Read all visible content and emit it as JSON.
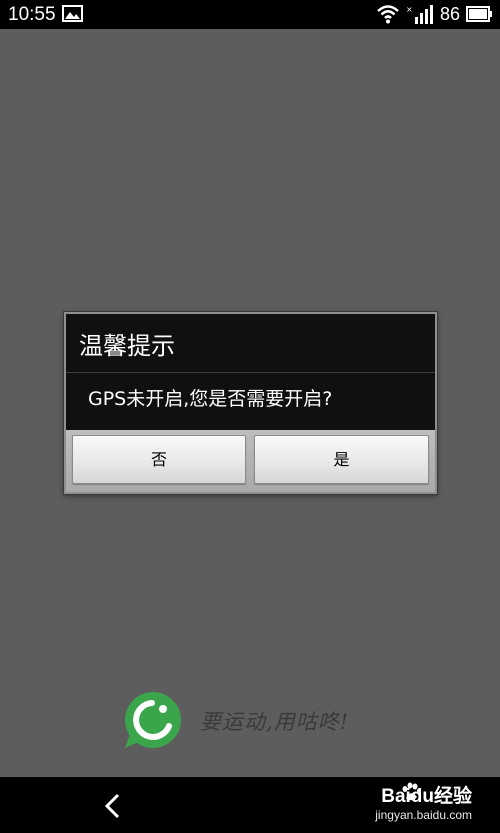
{
  "status_bar": {
    "time": "10:55",
    "battery": "86",
    "icons": [
      "image-notification-icon",
      "wifi-icon",
      "signal-icon",
      "battery-icon"
    ]
  },
  "dialog": {
    "title": "温馨提示",
    "message": "GPS未开启,您是否需要开启?",
    "negative_button": "否",
    "positive_button": "是"
  },
  "branding": {
    "slogan": "要运动,用咕咚!",
    "logo_color": "#3aa54a"
  },
  "nav_bar": {
    "back_icon": "back-icon"
  },
  "watermark": {
    "text": "Baidu经验",
    "url": "jingyan.baidu.com"
  },
  "colors": {
    "background": "#5d5d5d",
    "dialog_header": "#101010",
    "bars": "#000000"
  }
}
